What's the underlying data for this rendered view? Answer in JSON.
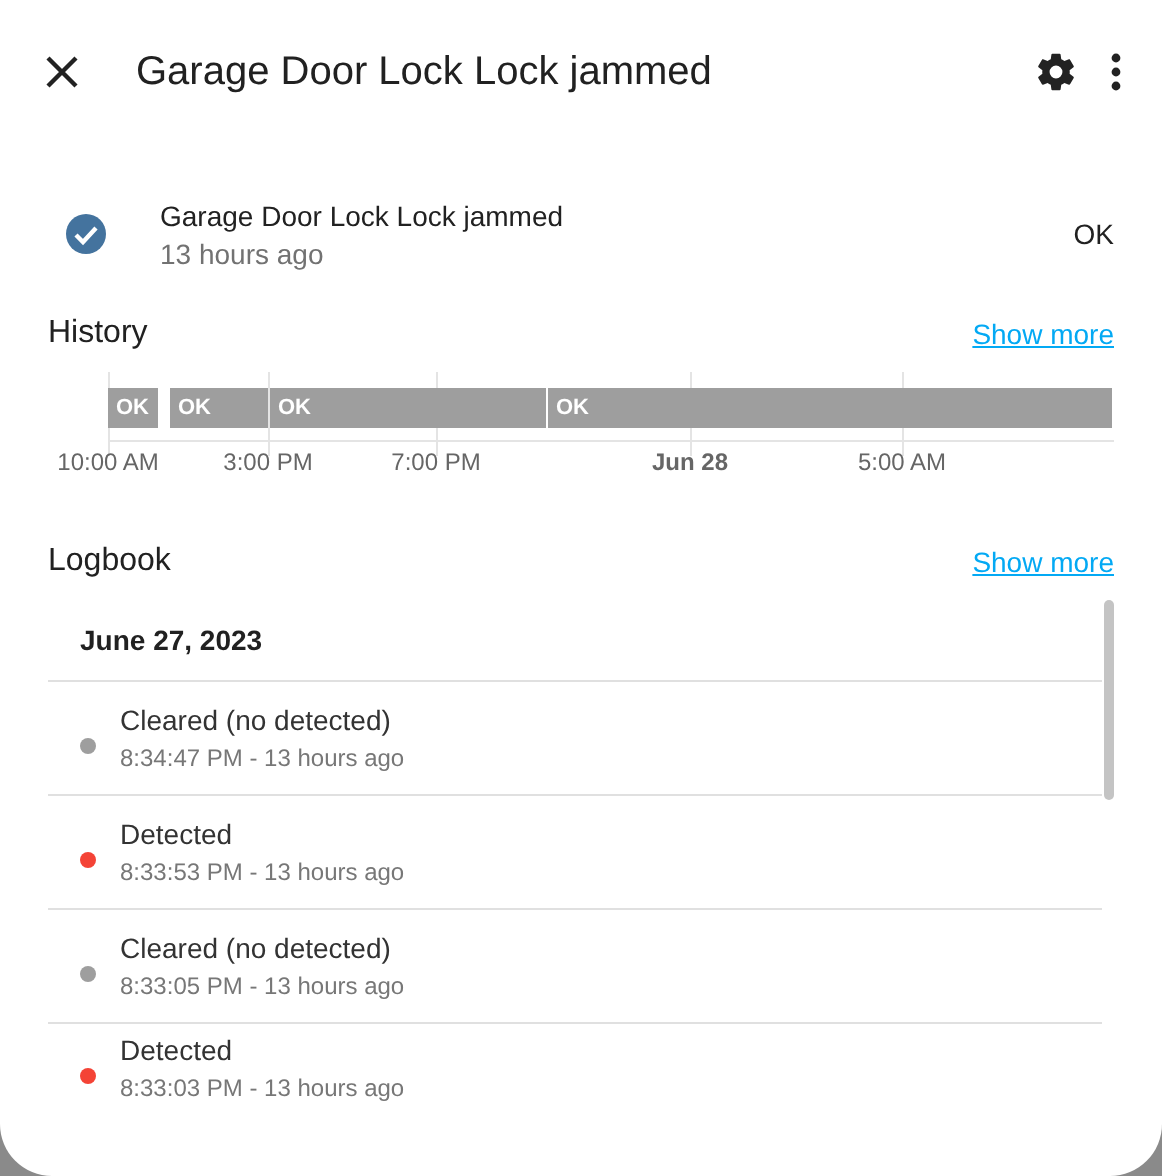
{
  "dialog": {
    "title": "Garage Door Lock Lock jammed"
  },
  "entity": {
    "name": "Garage Door Lock Lock jammed",
    "time": "13 hours ago",
    "state": "OK"
  },
  "history": {
    "title": "History",
    "link": "Show more",
    "segments": [
      {
        "label": "OK"
      },
      {
        "label": "OK"
      },
      {
        "label": "OK"
      },
      {
        "label": "OK"
      }
    ],
    "ticks": [
      {
        "label": "10:00 AM",
        "bold": false
      },
      {
        "label": "3:00 PM",
        "bold": false
      },
      {
        "label": "7:00 PM",
        "bold": false
      },
      {
        "label": "Jun 28",
        "bold": true
      },
      {
        "label": "5:00 AM",
        "bold": false
      }
    ]
  },
  "logbook": {
    "title": "Logbook",
    "link": "Show more",
    "date": "June 27, 2023",
    "entries": [
      {
        "message": "Cleared (no detected)",
        "time": "8:34:47 PM - 13 hours ago",
        "color": "#9e9e9e"
      },
      {
        "message": "Detected",
        "time": "8:33:53 PM - 13 hours ago",
        "color": "#f44336"
      },
      {
        "message": "Cleared (no detected)",
        "time": "8:33:05 PM - 13 hours ago",
        "color": "#9e9e9e"
      },
      {
        "message": "Detected",
        "time": "8:33:03 PM - 13 hours ago",
        "color": "#f44336"
      }
    ]
  }
}
